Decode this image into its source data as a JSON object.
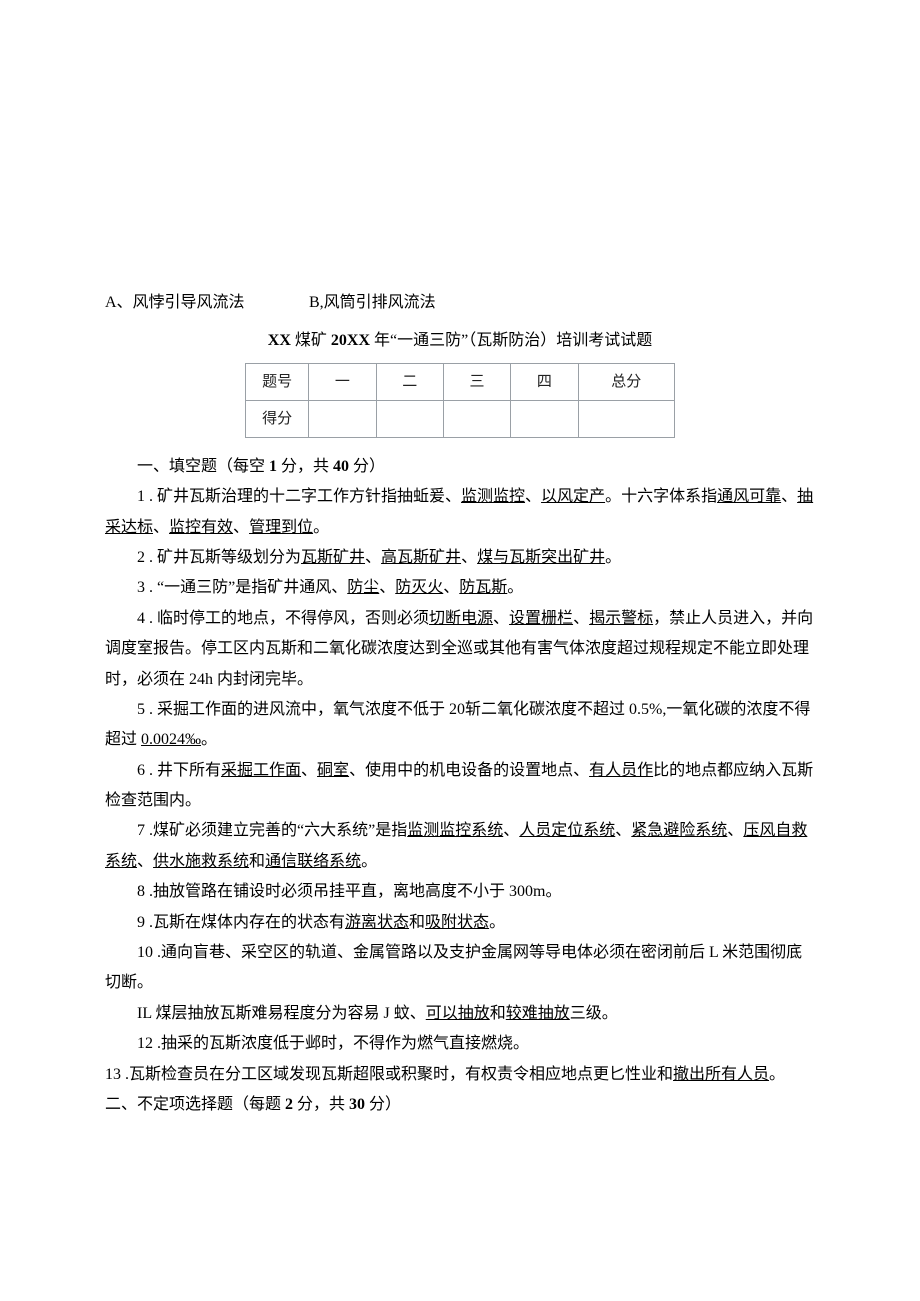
{
  "options": {
    "a": "A、风悖引导风流法",
    "b": "B,风筒引排风流法"
  },
  "title": {
    "prefix": "XX",
    "mid1": " 煤矿 ",
    "year": "20XX",
    "rest": " 年“一通三防”（瓦斯防治）培训考试试题"
  },
  "table": {
    "r1": {
      "c0": "题号",
      "c1": "一",
      "c2": "二",
      "c3": "三",
      "c4": "四",
      "c5": "总分"
    },
    "r2": {
      "c0": "得分"
    }
  },
  "section1": {
    "heading_a": "一、填空题（每空 ",
    "heading_pts": "1",
    "heading_b": " 分，共 ",
    "heading_total": "40",
    "heading_c": " 分）"
  },
  "q1": {
    "a": "1 . 矿井瓦斯治理的十二字工作方针指抽蚯爰、",
    "u1": "监测监控",
    "b": "、",
    "u2": "以风定产",
    "c": "。十六字体系指",
    "u3": "通风可靠",
    "d": "、",
    "u4": "抽采达标",
    "e": "、",
    "u5": "监控有效",
    "f": "、",
    "u6": "管理到位",
    "g": "。"
  },
  "q2": {
    "a": "2  . 矿井瓦斯等级划分为",
    "u1": "瓦斯矿井",
    "b": "、",
    "u2": "高瓦斯矿井",
    "c": "、",
    "u3": "煤与瓦斯突出矿井",
    "d": "。"
  },
  "q3": {
    "a": "3  . “一通三防”是指矿井通风、",
    "u1": "防尘",
    "b": "、",
    "u2": "防灭火",
    "c": "、",
    "u3": "防瓦斯",
    "d": "。"
  },
  "q4": {
    "a": "4  . 临时停工的地点，不得停风，否则必须",
    "u1": "切断电源",
    "b": "、",
    "u2": "设置栅栏",
    "c": "、",
    "u3": "揭示警标",
    "d": "，禁止人员进入，并向调度室报告。停工区内瓦斯和二氧化碳浓度达到全巡或其他有害气体浓度超过规程规定不能立即处理时，必须在 24h 内封闭完毕。"
  },
  "q5": {
    "a": "5  . 采掘工作面的进风流中，氧气浓度不低于 20斩二氧化碳浓度不超过 0.5%,一氧化碳的浓度不得超过 ",
    "u1": "0.0024‰",
    "b": "。"
  },
  "q6": {
    "a": "6  . 井下所有",
    "u1": "采掘工作面",
    "b": "、",
    "u2": "硐室",
    "c": "、使用中的机电设备的设置地点、",
    "u3": "有人员作",
    "d": "比的地点都应纳入瓦斯检查范围内。"
  },
  "q7": {
    "a": "7  .煤矿必须建立完善的“六大系统”是指",
    "u1": "监测监控系统",
    "b": "、",
    "u2": "人员定位系统",
    "c": "、",
    "u3": "紧急避险系统",
    "d": "、",
    "u4": "压风自救系统",
    "e": "、",
    "u5": "供水施救系统",
    "f": "和",
    "u6": "通信联络系统",
    "g": "。"
  },
  "q8": {
    "a": "8  .抽放管路在铺设时必须吊挂平直，离地高度不小于 300m。"
  },
  "q9": {
    "a": "9  .瓦斯在煤体内存在的状态有",
    "u1": "游离状态",
    "b": "和",
    "u2": "吸附状态",
    "c": "。"
  },
  "q10": {
    "a": "10  .通向盲巷、采空区的轨道、金属管路以及支护金属网等导电体必须在密闭前后 L 米范围彻底切断。"
  },
  "q11": {
    "a": "IL 煤层抽放瓦斯难易程度分为容易 J 蚊、",
    "u1": "可以抽放",
    "b": "和",
    "u2": "较难抽放",
    "c": "三级。"
  },
  "q12": {
    "a": "12  .抽采的瓦斯浓度低于邺时，不得作为燃气直接燃烧。"
  },
  "q13": {
    "a": "13  .瓦斯检查员在分工区域发现瓦斯超限或积聚时，有权责令相应地点更匕性业和",
    "u1": "撤出所有人员",
    "b": "。"
  },
  "section2": {
    "heading_a": "二、不定项选择题（每题 ",
    "heading_pts": "2",
    "heading_b": " 分，共 ",
    "heading_total": "30",
    "heading_c": " 分）"
  }
}
